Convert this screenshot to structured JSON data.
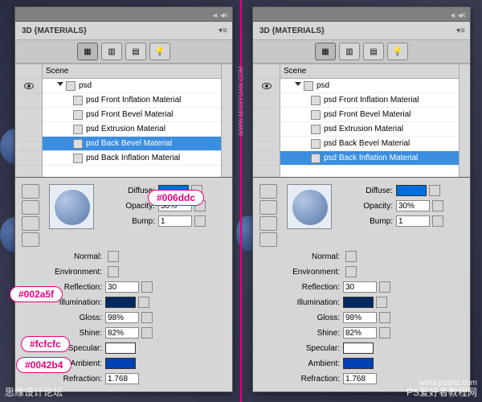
{
  "panel_title": "3D {MATERIALS}",
  "scene_label": "Scene",
  "root_node": "psd",
  "materials": [
    "psd Front Inflation Material",
    "psd Front Bevel Material",
    "psd Extrusion Material",
    "psd Back Bevel Material",
    "psd Back Inflation Material"
  ],
  "left_selected_index": 3,
  "right_selected_index": 4,
  "page_indicator": "",
  "props": {
    "diffuse_label": "Diffuse:",
    "opacity_label": "Opacity:",
    "opacity_value": "30%",
    "bump_label": "Bump:",
    "bump_value": "1",
    "normal_label": "Normal:",
    "environment_label": "Environment:",
    "reflection_label": "Reflection:",
    "reflection_value": "30",
    "illumination_label": "Illumination:",
    "gloss_label": "Gloss:",
    "gloss_value": "98%",
    "shine_label": "Shine:",
    "shine_value": "82%",
    "specular_label": "Specular:",
    "ambient_label": "Ambient:",
    "refraction_label": "Refraction:",
    "refraction_value": "1.768"
  },
  "colors": {
    "diffuse": "#006ddc",
    "illumination": "#002a5f",
    "specular": "#fcfcfc",
    "ambient": "#0042b4"
  },
  "callouts": {
    "c1": "#006ddc",
    "c2": "#002a5f",
    "c3": "#fcfcfc",
    "c4": "#0042b4"
  },
  "watermarks": {
    "bl": "思缘设计论坛",
    "br": "PS爱好者教程网",
    "cr": "WWW.MISSYUAN.COM",
    "site": "www.psahz.com"
  }
}
